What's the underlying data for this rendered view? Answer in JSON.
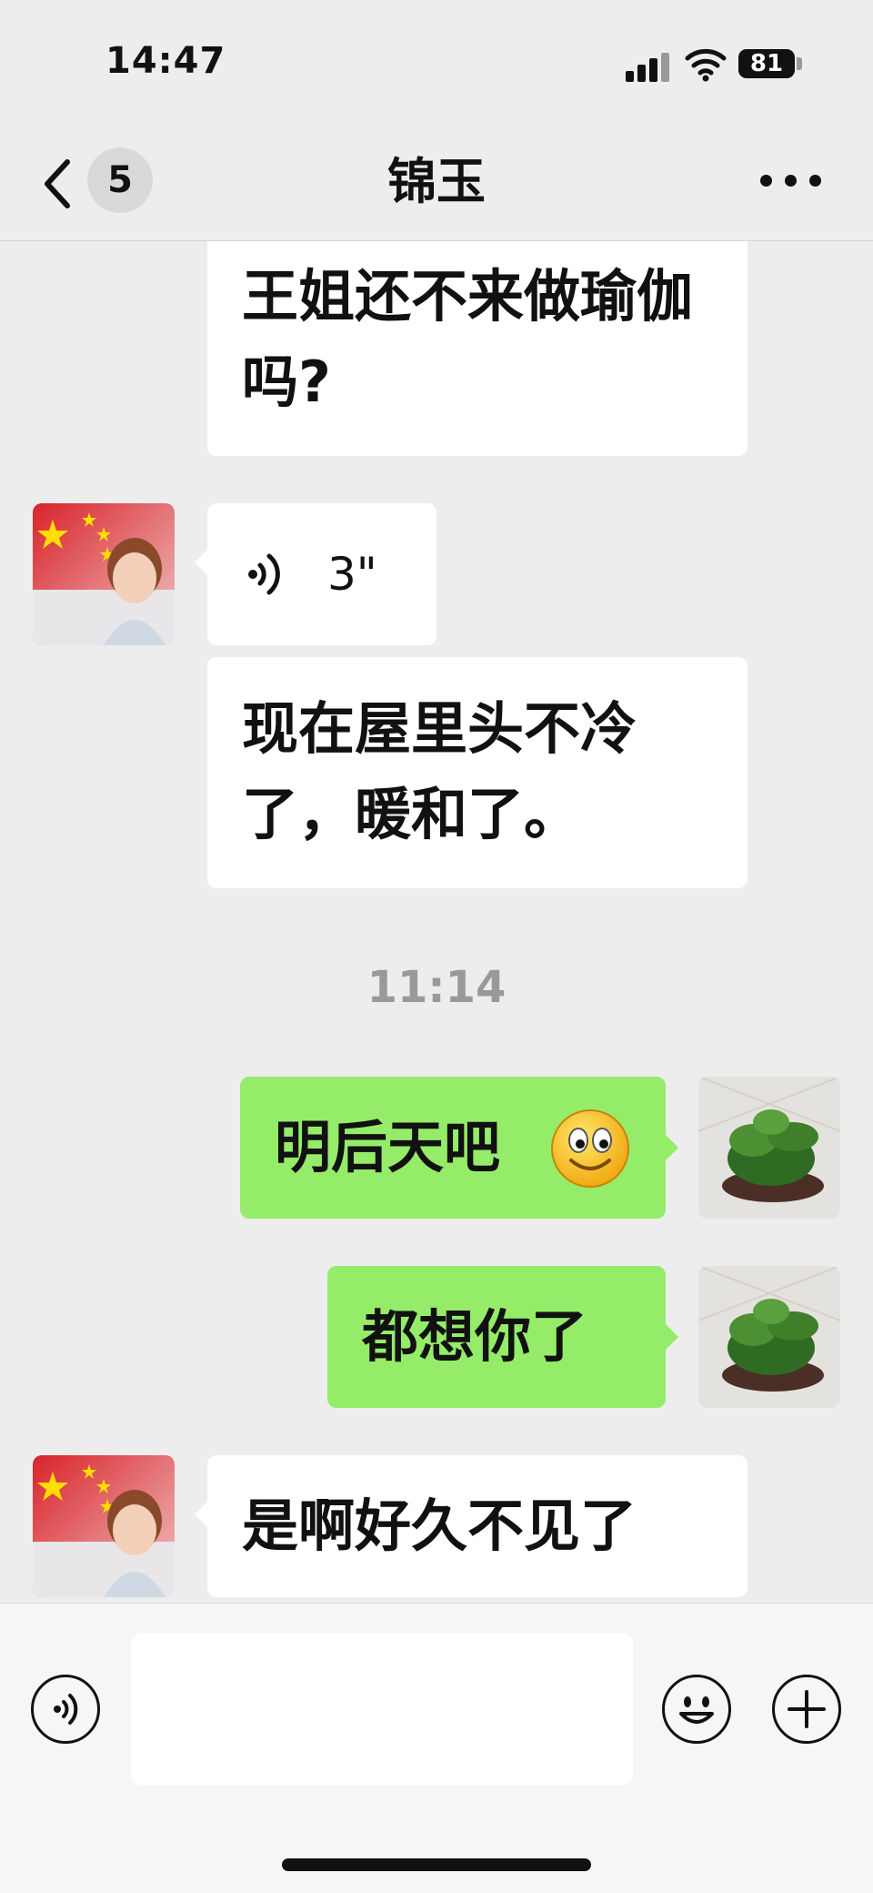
{
  "status_bar": {
    "time": "14:47",
    "battery": "81"
  },
  "header": {
    "unread_count": "5",
    "title": "锦玉"
  },
  "messages": [
    {
      "side": "in",
      "type": "text",
      "text": "王姐还不来做瑜伽吗?"
    },
    {
      "side": "in",
      "type": "voice",
      "duration": "3\""
    },
    {
      "side": "in",
      "type": "text",
      "text": "现在屋里头不冷了，暖和了。"
    },
    {
      "type": "timestamp",
      "text": "11:14"
    },
    {
      "side": "out",
      "type": "text",
      "text": "明后天吧",
      "emoji": "smile-emoji"
    },
    {
      "side": "out",
      "type": "text",
      "text": "都想你了"
    },
    {
      "side": "in",
      "type": "text",
      "text": "是啊好久不见了"
    }
  ],
  "icons": {
    "voice_input": "voice-input-icon",
    "emoji": "emoji-icon",
    "add": "plus-icon"
  },
  "colors": {
    "outgoing_bubble": "#95ec69",
    "incoming_bubble": "#ffffff",
    "background": "#ededed"
  }
}
